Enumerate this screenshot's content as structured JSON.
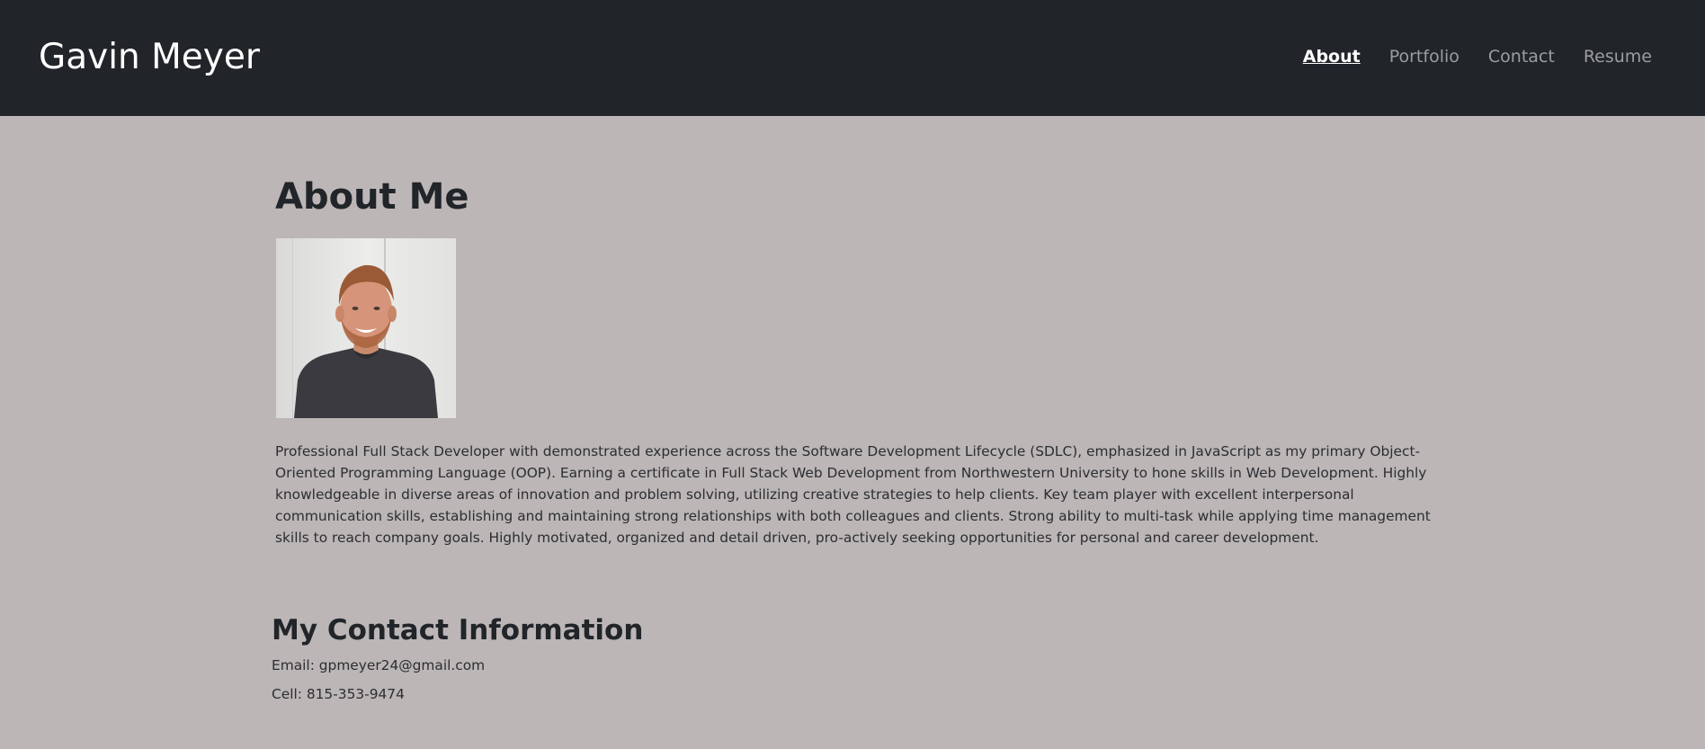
{
  "header": {
    "brand": "Gavin Meyer",
    "nav": [
      {
        "label": "About",
        "active": true
      },
      {
        "label": "Portfolio",
        "active": false
      },
      {
        "label": "Contact",
        "active": false
      },
      {
        "label": "Resume",
        "active": false
      }
    ]
  },
  "about": {
    "title": "About Me",
    "bio": "Professional Full Stack Developer with demonstrated experience across the Software Development Lifecycle (SDLC), emphasized in JavaScript as my primary Object-Oriented Programming Language (OOP). Earning a certificate in Full Stack Web Development from Northwestern University to hone skills in Web Development. Highly knowledgeable in diverse areas of innovation and problem solving, utilizing creative strategies to help clients. Key team player with excellent interpersonal communication skills, establishing and maintaining strong relationships with both colleagues and clients. Strong ability to multi-task while applying time management skills to reach company goals. Highly motivated, organized and detail driven, pro-actively seeking opportunities for personal and career development."
  },
  "contact": {
    "title": "My Contact Information",
    "email": "Email: gpmeyer24@gmail.com",
    "cell": "Cell: 815-353-9474"
  },
  "colors": {
    "navbar": "#212429",
    "background": "#bcb6b6",
    "nav_active": "#ffffff",
    "nav_inactive": "#9a9da1"
  }
}
